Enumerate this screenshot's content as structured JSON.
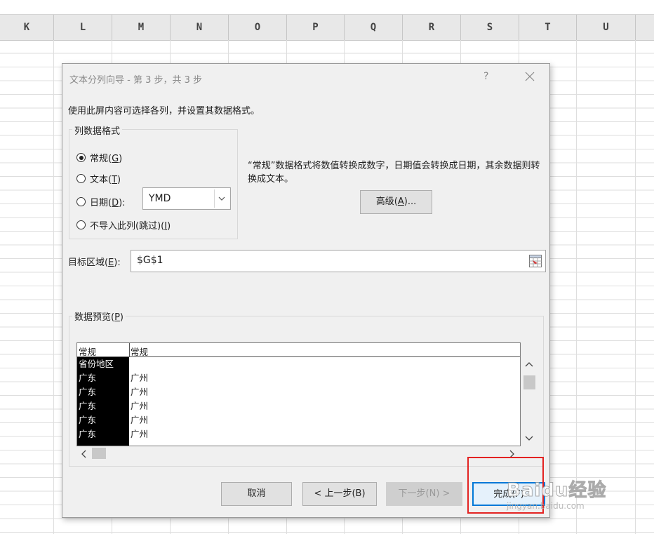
{
  "sheet": {
    "columns": [
      "K",
      "L",
      "M",
      "N",
      "O",
      "P",
      "Q",
      "R",
      "S",
      "T",
      "U"
    ]
  },
  "dialog": {
    "title": "文本分列向导 - 第 3 步，共 3 步",
    "help": "?",
    "instructions": "使用此屏内容可选择各列，并设置其数据格式。",
    "format_group": {
      "label": "列数据格式",
      "options": [
        {
          "text": "常规(",
          "key": "G",
          "suffix": ")",
          "checked": true
        },
        {
          "text": "文本(",
          "key": "T",
          "suffix": ")",
          "checked": false
        },
        {
          "text": "日期(",
          "key": "D",
          "suffix": "):",
          "checked": false
        },
        {
          "text": "不导入此列(跳过)(",
          "key": "I",
          "suffix": ")",
          "checked": false
        }
      ],
      "date_value": "YMD"
    },
    "format_description": "“常规”数据格式将数值转换成数字，日期值会转换成日期，其余数据则转换成文本。",
    "advanced_button": {
      "text": "高级(",
      "key": "A",
      "suffix": ")..."
    },
    "destination": {
      "label_text": "目标区域(",
      "label_key": "E",
      "label_suffix": "):",
      "value": "$G$1"
    },
    "preview": {
      "label_text": "数据预览(",
      "label_key": "P",
      "label_suffix": ")",
      "headers": [
        "常规",
        "常规"
      ],
      "rows": [
        [
          "省份地区",
          ""
        ],
        [
          "广东",
          "广州"
        ],
        [
          "广东",
          "广州"
        ],
        [
          "广东",
          "广州"
        ],
        [
          "广东",
          "广州"
        ],
        [
          "广东",
          "广州"
        ]
      ]
    },
    "buttons": {
      "cancel": "取消",
      "back": "< 上一步(B)",
      "next": "下一步(N) >",
      "finish": "完成(F)"
    }
  },
  "watermark": {
    "main": "Baidu经验",
    "sub": "jingyan.baidu.com"
  },
  "colors": {
    "dialog_bg": "#f0f0f0",
    "highlight": "#e32322",
    "accent": "#0078d7"
  }
}
